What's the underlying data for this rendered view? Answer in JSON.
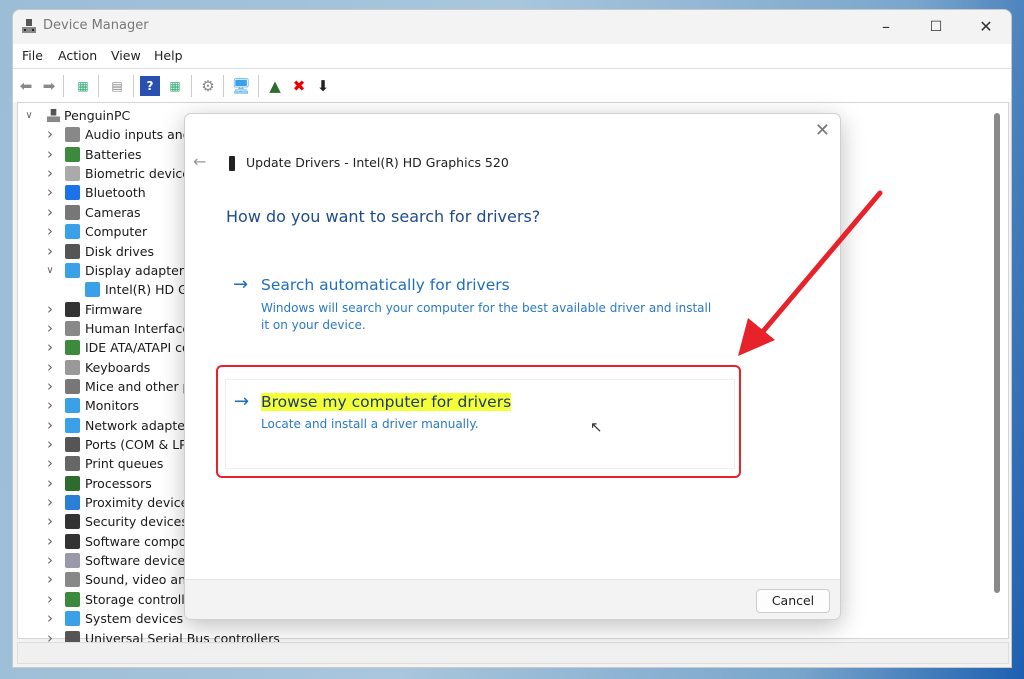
{
  "window": {
    "title": "Device Manager",
    "controls": [
      "minimize",
      "maximize",
      "close"
    ]
  },
  "menu": [
    "File",
    "Action",
    "View",
    "Help"
  ],
  "toolbar": [
    "back-icon",
    "forward-icon",
    "properties-icon",
    "view-icon",
    "help-icon",
    "show-icon",
    "scan-icon",
    "monitor-icon",
    "update-driver-icon",
    "uninstall-icon",
    "disable-icon"
  ],
  "tree": {
    "root": "PenguinPC",
    "items": [
      {
        "label": "Audio inputs and",
        "color": "#888"
      },
      {
        "label": "Batteries",
        "color": "#3c8a3c"
      },
      {
        "label": "Biometric devices",
        "color": "#aaa"
      },
      {
        "label": "Bluetooth",
        "color": "#1a73e8"
      },
      {
        "label": "Cameras",
        "color": "#777"
      },
      {
        "label": "Computer",
        "color": "#3aa0e8"
      },
      {
        "label": "Disk drives",
        "color": "#555"
      },
      {
        "label": "Display adapters",
        "color": "#3aa0e8",
        "expanded": true
      },
      {
        "label": "Intel(R) HD Gra",
        "color": "#3aa0e8",
        "child": true
      },
      {
        "label": "Firmware",
        "color": "#333"
      },
      {
        "label": "Human Interface D",
        "color": "#888"
      },
      {
        "label": "IDE ATA/ATAPI cont",
        "color": "#3c8a3c"
      },
      {
        "label": "Keyboards",
        "color": "#999"
      },
      {
        "label": "Mice and other po",
        "color": "#777"
      },
      {
        "label": "Monitors",
        "color": "#3aa0e8"
      },
      {
        "label": "Network adapters",
        "color": "#3aa0e8"
      },
      {
        "label": "Ports (COM & LPT)",
        "color": "#555"
      },
      {
        "label": "Print queues",
        "color": "#666"
      },
      {
        "label": "Processors",
        "color": "#2e6b2e"
      },
      {
        "label": "Proximity devices",
        "color": "#2a7fd6"
      },
      {
        "label": "Security devices",
        "color": "#333"
      },
      {
        "label": "Software compone",
        "color": "#333"
      },
      {
        "label": "Software devices",
        "color": "#99a"
      },
      {
        "label": "Sound, video and",
        "color": "#888"
      },
      {
        "label": "Storage controller",
        "color": "#3c8a3c"
      },
      {
        "label": "System devices",
        "color": "#3aa0e8"
      },
      {
        "label": "Universal Serial Bus controllers",
        "color": "#555"
      }
    ]
  },
  "dialog": {
    "title": "Update Drivers - Intel(R) HD Graphics 520",
    "question": "How do you want to search for drivers?",
    "option1": {
      "title": "Search automatically for drivers",
      "desc": "Windows will search your computer for the best available driver and install it on your device."
    },
    "option2": {
      "title": "Browse my computer for drivers",
      "desc": "Locate and install a driver manually."
    },
    "cancel": "Cancel"
  },
  "annotation": {
    "color": "#e8222a"
  }
}
